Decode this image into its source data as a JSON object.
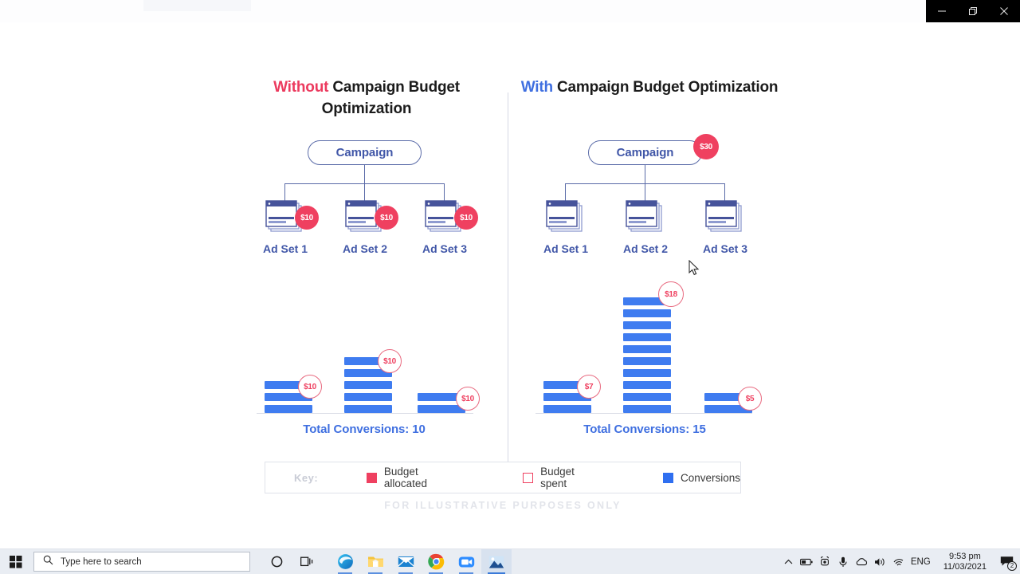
{
  "window_controls": {
    "minimize": "minimize-icon",
    "restore": "restore-icon",
    "close": "close-icon"
  },
  "slide": {
    "footnote": "FOR ILLUSTRATIVE PURPOSES ONLY",
    "panels": [
      {
        "id": "without",
        "heading_highlight": "Without",
        "heading_rest": "Campaign Budget Optimization",
        "campaign_label": "Campaign",
        "campaign_badge": null,
        "adsets": [
          {
            "label": "Ad Set 1",
            "badge": "$10"
          },
          {
            "label": "Ad Set 2",
            "badge": "$10"
          },
          {
            "label": "Ad Set 3",
            "badge": "$10"
          }
        ],
        "total_conversions_label": "Total Conversions: 10"
      },
      {
        "id": "with",
        "heading_highlight": "With",
        "heading_rest": "Campaign Budget Optimization",
        "campaign_label": "Campaign",
        "campaign_badge": "$30",
        "adsets": [
          {
            "label": "Ad Set 1",
            "badge": null
          },
          {
            "label": "Ad Set 2",
            "badge": null
          },
          {
            "label": "Ad Set 3",
            "badge": null
          }
        ],
        "total_conversions_label": "Total Conversions: 15"
      }
    ],
    "key": {
      "label": "Key:",
      "items": [
        {
          "swatch": "allocated",
          "text": "Budget allocated",
          "color": "#ef4060"
        },
        {
          "swatch": "spent",
          "text": "Budget spent",
          "color": "#ef4060"
        },
        {
          "swatch": "conversions",
          "text": "Conversions",
          "color": "#2f6ff0"
        }
      ]
    }
  },
  "chart_data": [
    {
      "type": "bar",
      "title": "Without Campaign Budget Optimization",
      "categories": [
        "Ad Set 1",
        "Ad Set 2",
        "Ad Set 3"
      ],
      "values": [
        3,
        5,
        2
      ],
      "spend_labels": [
        "$10",
        "$10",
        "$10"
      ],
      "allocated_labels": [
        "$10",
        "$10",
        "$10"
      ],
      "total": 10,
      "xlabel": "",
      "ylabel": "Conversions",
      "ylim": [
        0,
        10
      ],
      "grid": false,
      "legend": "bottom",
      "series": [
        {
          "name": "Conversions",
          "values": [
            3,
            5,
            2
          ],
          "color": "#3f7cf0"
        }
      ]
    },
    {
      "type": "bar",
      "title": "With Campaign Budget Optimization",
      "categories": [
        "Ad Set 1",
        "Ad Set 2",
        "Ad Set 3"
      ],
      "values": [
        3,
        10,
        2
      ],
      "spend_labels": [
        "$7",
        "$18",
        "$5"
      ],
      "allocated_labels": [
        "$30"
      ],
      "total": 15,
      "xlabel": "",
      "ylabel": "Conversions",
      "ylim": [
        0,
        10
      ],
      "grid": false,
      "legend": "bottom",
      "series": [
        {
          "name": "Conversions",
          "values": [
            3,
            10,
            2
          ],
          "color": "#3f7cf0"
        }
      ]
    }
  ],
  "taskbar": {
    "start": "windows-logo-icon",
    "search_placeholder": "Type here to search",
    "buttons": [
      {
        "name": "cortana-icon",
        "glyph": "cortana"
      },
      {
        "name": "task-view-icon",
        "glyph": "taskview"
      },
      {
        "name": "edge-icon",
        "glyph": "edge"
      },
      {
        "name": "file-explorer-icon",
        "glyph": "explorer"
      },
      {
        "name": "mail-icon",
        "glyph": "mail"
      },
      {
        "name": "chrome-icon",
        "glyph": "chrome"
      },
      {
        "name": "zoom-icon",
        "glyph": "zoom"
      },
      {
        "name": "photos-icon",
        "glyph": "photos"
      }
    ],
    "tray": {
      "language": "ENG",
      "time": "9:53 pm",
      "date": "11/03/2021",
      "notification_count": "2"
    }
  }
}
